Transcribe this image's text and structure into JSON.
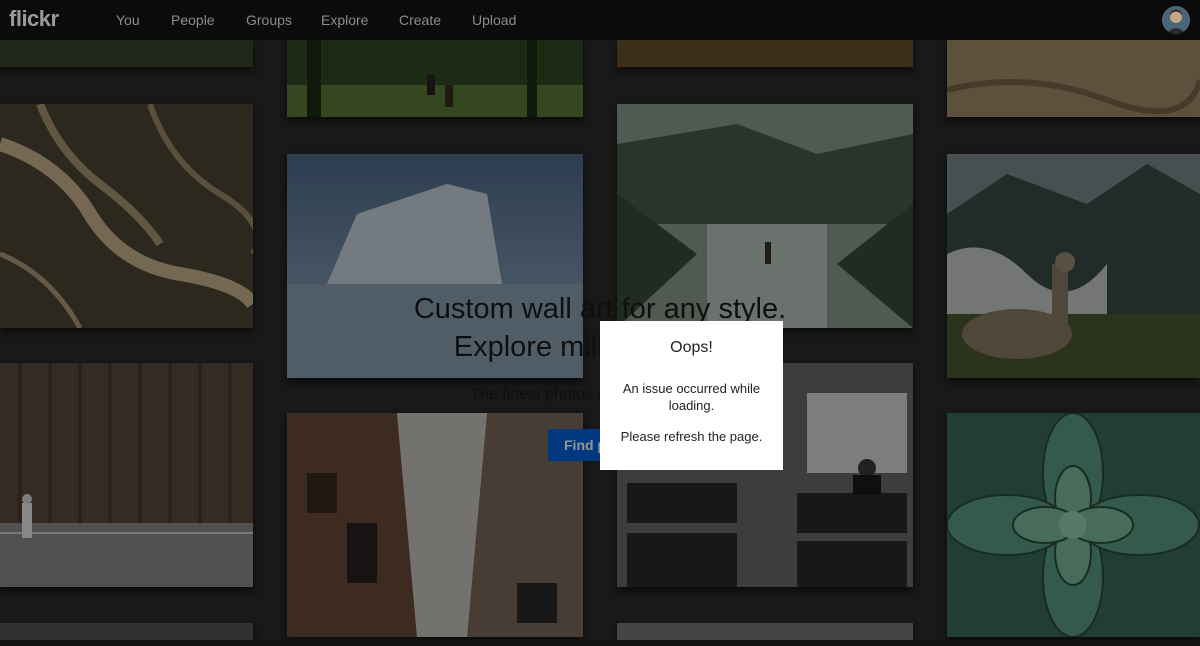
{
  "nav": {
    "logo": "flickr",
    "items": [
      {
        "label": "You"
      },
      {
        "label": "People"
      },
      {
        "label": "Groups"
      },
      {
        "label": "Explore"
      },
      {
        "label": "Create"
      },
      {
        "label": "Upload"
      }
    ]
  },
  "hero": {
    "title_line1": "Custom wall art for any style.",
    "title_line2": "Explore millio",
    "subtitle": "The finest photos on F",
    "button_label": "Find p"
  },
  "modal": {
    "title": "Oops!",
    "message": "An issue occurred while loading.",
    "refresh": "Please refresh the page."
  },
  "photos": [
    {
      "name": "forest-hikers-photo"
    },
    {
      "name": "wheat-field-photo"
    },
    {
      "name": "sand-dunes-photo"
    },
    {
      "name": "aerial-river-delta-photo"
    },
    {
      "name": "iceberg-photo"
    },
    {
      "name": "fjord-person-photo"
    },
    {
      "name": "llama-mountains-photo"
    },
    {
      "name": "wooden-wall-walker-photo"
    },
    {
      "name": "narrow-street-photo"
    },
    {
      "name": "train-interior-photo"
    },
    {
      "name": "succulent-plant-photo"
    }
  ]
}
